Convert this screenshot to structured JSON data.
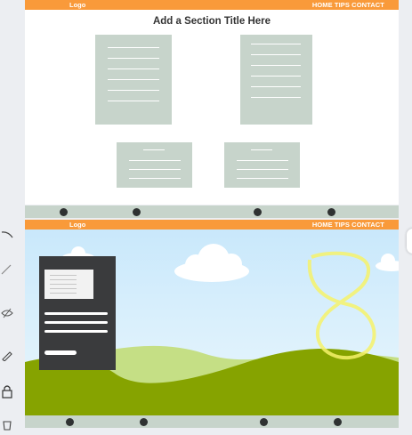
{
  "header": {
    "logo": "Logo",
    "nav": "HOME  TIPS  CONTACT"
  },
  "section": {
    "title": "Add a Section Title Here"
  },
  "toolbar": {
    "icons": [
      "curve-tool-icon",
      "pen-icon",
      "eye-hidden-icon",
      "pencil-icon",
      "lock-icon",
      "trash-icon"
    ]
  },
  "colors": {
    "header": "#f99a3a",
    "card": "#c7d4cb",
    "hero_card": "#3a3b3d",
    "hill_dark": "#86a300",
    "hill_light": "#c5df85",
    "highlight": "#f6f26a"
  }
}
